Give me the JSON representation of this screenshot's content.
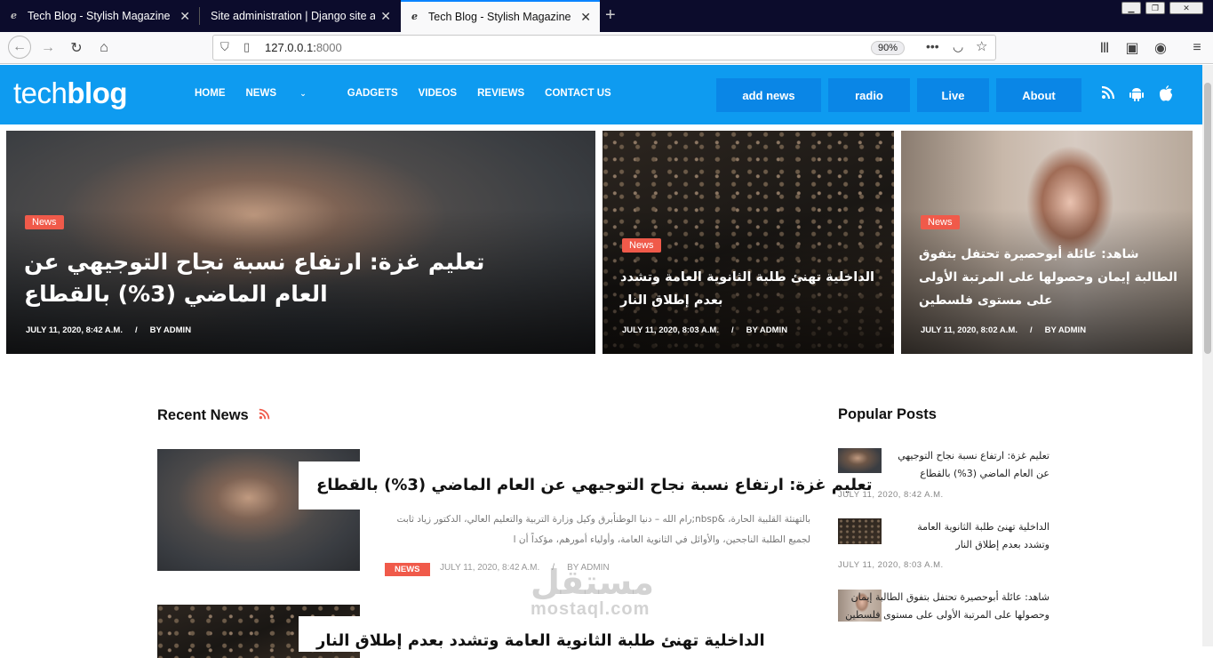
{
  "browser": {
    "tabs": [
      {
        "title": "Tech Blog - Stylish Magazine Bl",
        "favicon": "e"
      },
      {
        "title": "Site administration | Django site adn",
        "favicon": ""
      },
      {
        "title": "Tech Blog - Stylish Magazine Bl",
        "favicon": "e"
      }
    ],
    "url_host": "127.0.0.1:",
    "url_port": "8000",
    "zoom": "90%"
  },
  "site": {
    "logo_light": "tech",
    "logo_bold": "blog",
    "menu": [
      "HOME",
      "NEWS",
      "GADGETS",
      "VIDEOS",
      "REVIEWS",
      "CONTACT US"
    ],
    "buttons": [
      "add news",
      "radio",
      "Live",
      "About"
    ]
  },
  "hero": [
    {
      "badge": "News",
      "title": "تعليم غزة: ارتفاع نسبة نجاح التوجيهي عن العام الماضي (3%) بالقطاع",
      "date": "JULY 11, 2020, 8:42 A.M.",
      "author": "BY ADMIN"
    },
    {
      "badge": "News",
      "title": "الداخلية تهنئ طلبة الثانوية العامة وتشدد بعدم إطلاق النار",
      "date": "JULY 11, 2020, 8:03 A.M.",
      "author": "BY ADMIN"
    },
    {
      "badge": "News",
      "title": "شاهد: عائلة أبوحصيرة تحتفل بتفوق الطالبة إيمان وحصولها على المرتبة الأولى على مستوى فلسطين",
      "date": "JULY 11, 2020, 8:02 A.M.",
      "author": "BY ADMIN"
    }
  ],
  "recent": {
    "heading": "Recent News",
    "items": [
      {
        "title": "تعليم غزة: ارتفاع نسبة نجاح التوجيهي عن العام الماضي (3%) بالقطاع",
        "excerpt_1": "بالتهنئة القلبية الحارة، &nbsp;رام الله – دنيا الوطنأبرق وكيل وزارة التربية والتعليم العالي، الدكتور زياد ثابت",
        "excerpt_2": "لجميع الطلبة الناجحين، والأوائل في الثانوية العامة، وأولياء أمورهم، مؤكداً أن ا",
        "badge": "NEWS",
        "date": "JULY 11, 2020, 8:42 A.M.",
        "author": "BY ADMIN"
      },
      {
        "title": "الداخلية تهنئ طلبة الثانوية العامة وتشدد بعدم إطلاق النار"
      }
    ]
  },
  "popular": {
    "heading": "Popular Posts",
    "items": [
      {
        "title": "تعليم غزة: ارتفاع نسبة نجاح التوجيهي عن العام الماضي (3%) بالقطاع",
        "date": "JULY 11, 2020, 8:42 A.M."
      },
      {
        "title": "الداخلية تهنئ طلبة الثانوية العامة وتشدد بعدم إطلاق النار",
        "date": "JULY 11, 2020, 8:03 A.M."
      },
      {
        "title": "شاهد: عائلة أبوحصيرة تحتفل بتفوق الطالبة إيمان وحصولها على المرتبة الأولى على مستوى فلسطين",
        "date": ""
      }
    ]
  },
  "watermark": {
    "line1": "مستقل",
    "line2": "mostaql.com"
  }
}
